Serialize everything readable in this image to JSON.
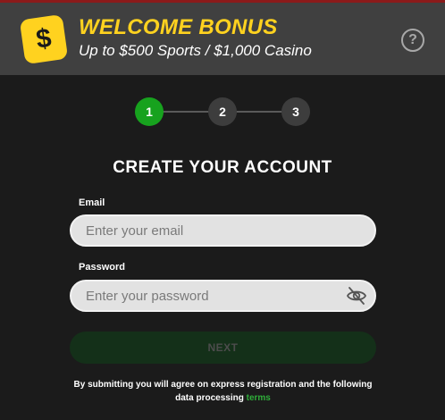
{
  "bonus": {
    "icon": "dollar-icon",
    "icon_glyph": "$",
    "title": "WELCOME BONUS",
    "subtitle": "Up to $500 Sports / $1,000 Casino",
    "help_glyph": "?",
    "accent_color": "#ffd21f"
  },
  "stepper": {
    "steps": [
      "1",
      "2",
      "3"
    ],
    "active_step": 1,
    "active_color": "#17a21e"
  },
  "form": {
    "title": "CREATE YOUR ACCOUNT",
    "email": {
      "label": "Email",
      "placeholder": "Enter your email",
      "value": ""
    },
    "password": {
      "label": "Password",
      "placeholder": "Enter your password",
      "value": "",
      "toggle_icon": "eye-off-icon"
    },
    "next_label": "NEXT",
    "disclaimer_text": "By submitting you will agree on express registration and the following data processing",
    "terms_label": "terms",
    "link_color": "#2fae3a"
  }
}
